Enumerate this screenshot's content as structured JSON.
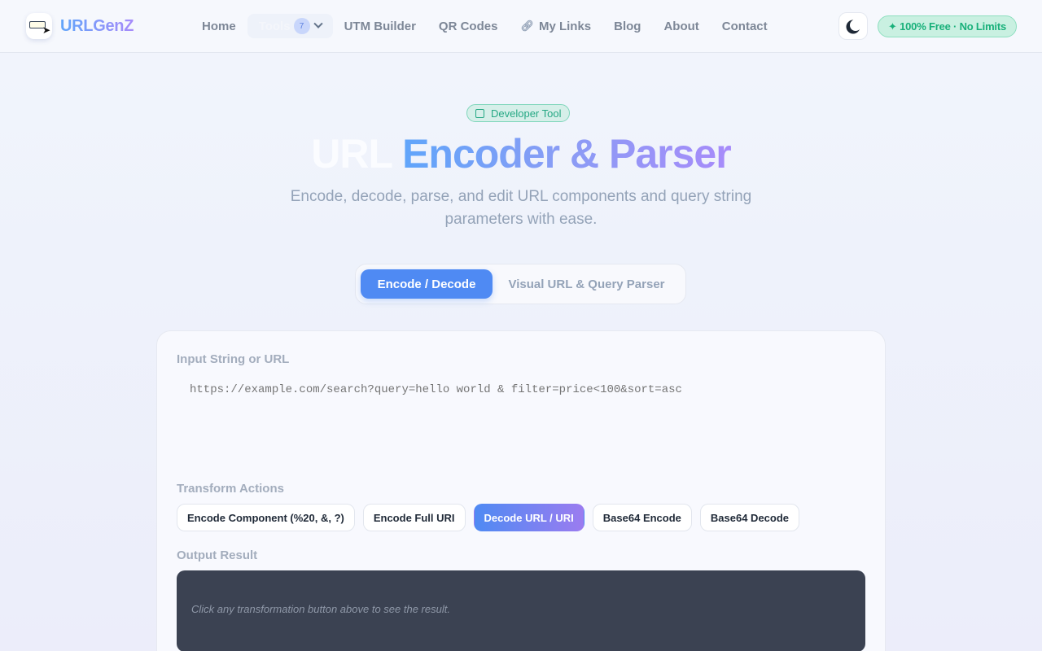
{
  "brand": {
    "name": "URLGenZ"
  },
  "nav": {
    "items": [
      {
        "label": "Home"
      },
      {
        "label": "Tools",
        "count": "7"
      },
      {
        "label": "UTM Builder"
      },
      {
        "label": "QR Codes"
      },
      {
        "label": "My Links"
      },
      {
        "label": "Blog"
      },
      {
        "label": "About"
      },
      {
        "label": "Contact"
      }
    ]
  },
  "header": {
    "free_badge": "✦ 100% Free · No Limits"
  },
  "hero": {
    "pill": "Developer Tool",
    "title_white": "URL",
    "title_gradient": "Encoder & Parser",
    "subtitle": "Encode, decode, parse, and edit URL components and query string parameters with ease."
  },
  "tabs": [
    {
      "label": "Encode / Decode",
      "active": true
    },
    {
      "label": "Visual URL & Query Parser",
      "active": false
    }
  ],
  "card": {
    "input_label": "Input String or URL",
    "input_placeholder": "https://example.com/search?query=hello world & filter=price<100&sort=asc",
    "actions_label": "Transform Actions",
    "actions": [
      {
        "label": "Encode Component (%20, &, ?)"
      },
      {
        "label": "Encode Full URI"
      },
      {
        "label": "Decode URL / URI",
        "active": true
      },
      {
        "label": "Base64 Encode"
      },
      {
        "label": "Base64 Decode"
      }
    ],
    "output_label": "Output Result",
    "output_placeholder": "Click any transformation button above to see the result."
  },
  "colors": {
    "accent": "#4f8af3",
    "accent2": "#a78bfa",
    "success": "#18b07a"
  }
}
